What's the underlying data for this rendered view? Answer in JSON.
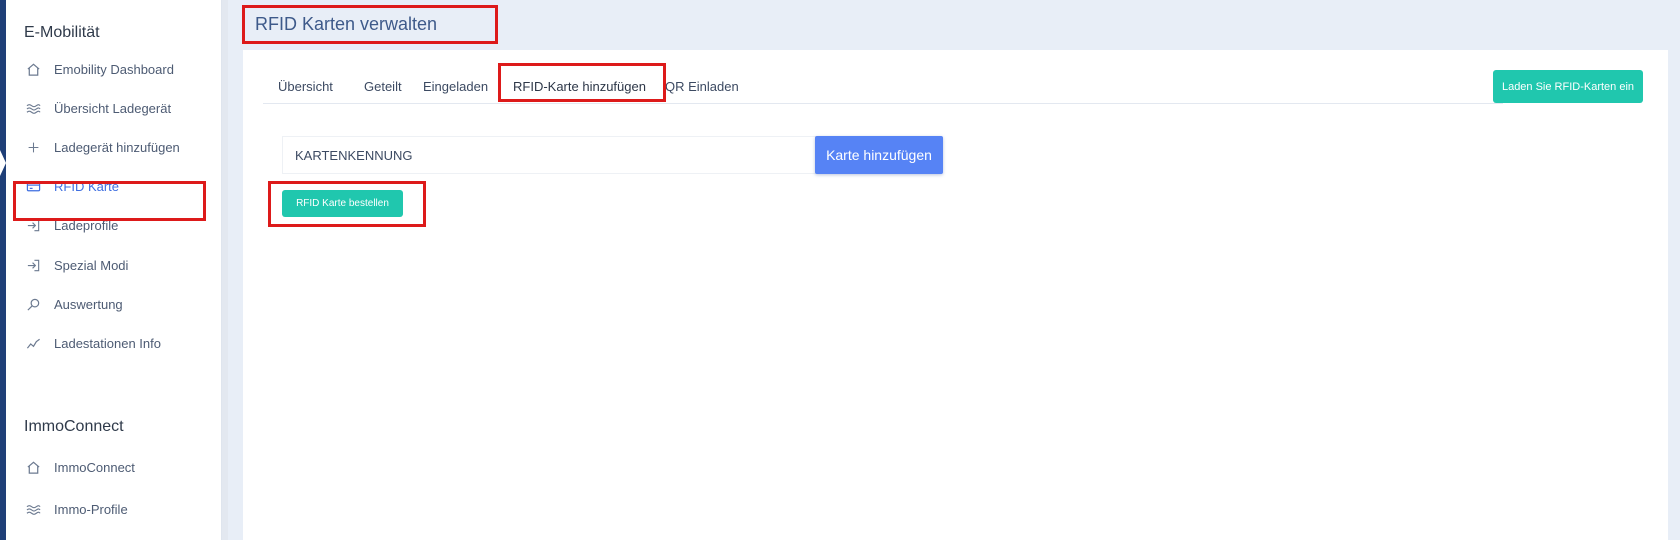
{
  "sidebar": {
    "sections": [
      {
        "title": "E-Mobilität",
        "items": [
          {
            "label": "Emobility Dashboard",
            "icon": "home-icon"
          },
          {
            "label": "Übersicht Ladegerät",
            "icon": "waves-icon"
          },
          {
            "label": "Ladegerät hinzufügen",
            "icon": "plus-icon"
          },
          {
            "label": "RFID Karte",
            "icon": "card-icon",
            "active": true
          },
          {
            "label": "Ladeprofile",
            "icon": "login-icon"
          },
          {
            "label": "Spezial Modi",
            "icon": "login-icon"
          },
          {
            "label": "Auswertung",
            "icon": "search-icon"
          },
          {
            "label": "Ladestationen Info",
            "icon": "trend-icon"
          }
        ]
      },
      {
        "title": "ImmoConnect",
        "items": [
          {
            "label": "ImmoConnect",
            "icon": "home-icon"
          },
          {
            "label": "Immo-Profile",
            "icon": "waves-icon"
          }
        ]
      }
    ]
  },
  "header": {
    "title": "RFID Karten verwalten"
  },
  "tabs": [
    {
      "label": "Übersicht"
    },
    {
      "label": "Geteilt"
    },
    {
      "label": "Eingeladen"
    },
    {
      "label": "RFID-Karte hinzufügen",
      "active": true
    },
    {
      "label": "QR Einladen"
    }
  ],
  "actions": {
    "load_cards_label": "Laden Sie RFID-Karten ein",
    "add_card_label": "Karte hinzufügen",
    "order_card_label": "RFID Karte bestellen"
  },
  "form": {
    "card_id_placeholder": "KARTENKENNUNG"
  },
  "colors": {
    "accent": "#5683f5",
    "teal": "#20c7ae",
    "highlight": "#dd1a1a",
    "sidebar_strip": "#1f3f78"
  }
}
